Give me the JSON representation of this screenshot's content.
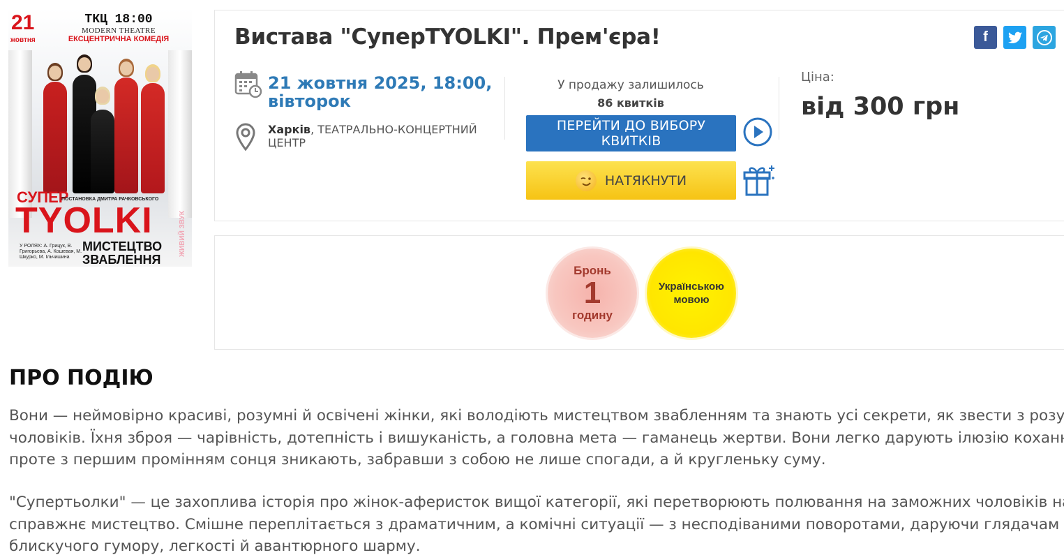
{
  "poster": {
    "date_num": "21",
    "date_month": "жовтня",
    "time_line": "ТКЦ 18:00",
    "venue_line": "MODERN THEATRE",
    "genre_line": "ЕКСЦЕНТРИЧНА КОМЕДІЯ",
    "title_super": "СУПЕР",
    "director": "ПОСТАНОВКА ДМИТРА РАЧКОВСЬКОГО",
    "title_tyolki": "TYOLKI",
    "cast": "У РОЛЯХ: А. Грицук, В. Григорьєва, А. Кошевая, М. Шкурко, М. Ільчишина",
    "art_line1": "МИСТЕЦТВО",
    "art_line2": "ЗВАБЛЕННЯ",
    "live_sound": "ЖИВИЙ ЗВУК"
  },
  "event": {
    "title": "Вистава \"СуперTYOLKI\". Прем'єра!",
    "date_line1": "21 жовтня 2025, 18:00,",
    "date_line2": "вівторок",
    "city": "Харків",
    "venue_sep": ", ",
    "venue": "ТЕАТРАЛЬНО-КОНЦЕРТНИЙ ЦЕНТР",
    "remaining_label": "У продажу залишилось",
    "remaining_count": "86 квитків",
    "buy_button": "ПЕРЕЙТИ ДО ВИБОРУ КВИТКІВ",
    "tease_button": "НАТЯКНУТИ",
    "price_label": "Ціна:",
    "price_value": "від 300 грн"
  },
  "social": {
    "facebook": "f",
    "twitter": "t",
    "telegram": "telegram-icon"
  },
  "badges": {
    "bron_line1": "Бронь",
    "bron_num": "1",
    "bron_line3": "годину",
    "lang_line1": "Українською",
    "lang_line2": "мовою"
  },
  "about": {
    "title": "ПРО ПОДІЮ",
    "p1": [
      "Вони — неймовірно красиві, розумні й освічені жінки, які володіють мистецтвом звабленням та знають усі секрети, як звести з розуму",
      "чоловіків. Їхня зброя — чарівність, дотепність і вишуканість, а головна мета — гаманець жертви. Вони легко дарують ілюзію кохання,",
      "проте з першим промінням сонця зникають, забравши з собою не лише спогади, а й кругленьку суму."
    ],
    "p2": [
      "\"Супертьолки\" — це захоплива історія про жінок-аферисток вищої категорії, які перетворюють полювання на заможних чоловіків на",
      "справжнє мистецтво. Смішне переплітається з драматичним, а комічні ситуації — з несподіваними поворотами, даруючи глядачам вечір",
      "блискучого гумору, легкості й авантюрного шарму."
    ]
  },
  "colors": {
    "accent_blue": "#2a73bf",
    "date_blue": "#2e7ab6",
    "poster_red": "#d9141b",
    "tease_yellow": "#f6c314"
  }
}
